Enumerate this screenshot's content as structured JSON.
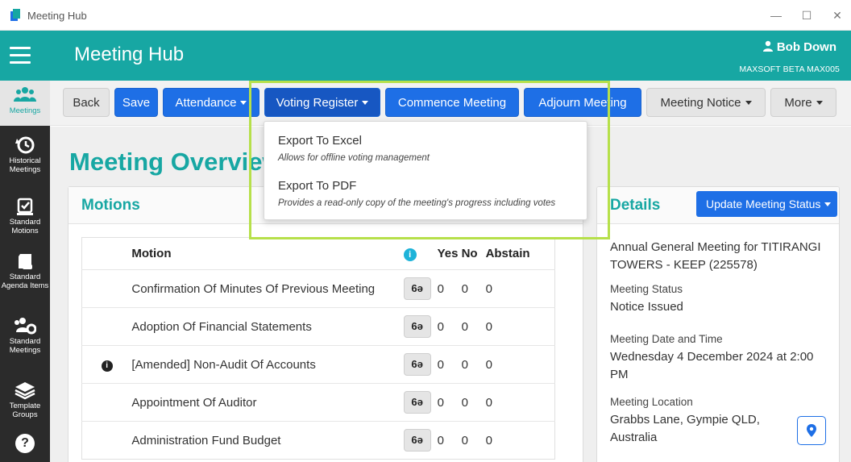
{
  "window": {
    "title": "Meeting Hub",
    "controls": [
      "—",
      "☐",
      "✕"
    ]
  },
  "header": {
    "title": "Meeting Hub",
    "user_name": "Bob Down",
    "user_sub": "MAXSOFT BETA MAX005"
  },
  "sidebar": {
    "items": [
      {
        "label": "Meetings",
        "icon": "people-group-icon",
        "active": true
      },
      {
        "label": "Historical Meetings",
        "icon": "history-icon"
      },
      {
        "label": "Standard Motions",
        "icon": "check-box-icon"
      },
      {
        "label": "Standard Agenda Items",
        "icon": "scroll-icon"
      },
      {
        "label": "Standard Meetings",
        "icon": "people-gear-icon"
      },
      {
        "label": "Template Groups",
        "icon": "layers-icon"
      },
      {
        "label": "?",
        "icon": "help-icon"
      }
    ]
  },
  "toolbar": {
    "back": "Back",
    "save": "Save",
    "attendance": "Attendance",
    "voting_register": "Voting Register",
    "commence": "Commence Meeting",
    "adjourn": "Adjourn Meeting",
    "notice": "Meeting Notice",
    "more": "More"
  },
  "dropdown": {
    "items": [
      {
        "label": "Export To Excel",
        "desc": "Allows for offline voting management"
      },
      {
        "label": "Export To PDF",
        "desc": "Provides a read-only copy of the meeting's progress including votes"
      }
    ]
  },
  "page": {
    "title": "Meeting Overview"
  },
  "motions": {
    "title": "Motions",
    "columns": {
      "motion": "Motion",
      "info": "i",
      "yes": "Yes",
      "no": "No",
      "abstain": "Abstain"
    },
    "view_glyph": "6ə",
    "rows": [
      {
        "name": "Confirmation Of Minutes Of Previous Meeting",
        "yes": "0",
        "no": "0",
        "abstain": "0",
        "flag": ""
      },
      {
        "name": "Adoption Of Financial Statements",
        "yes": "0",
        "no": "0",
        "abstain": "0",
        "flag": ""
      },
      {
        "name": "[Amended] Non-Audit Of Accounts",
        "yes": "0",
        "no": "0",
        "abstain": "0",
        "flag": "i"
      },
      {
        "name": "Appointment Of Auditor",
        "yes": "0",
        "no": "0",
        "abstain": "0",
        "flag": ""
      },
      {
        "name": "Administration Fund Budget",
        "yes": "0",
        "no": "0",
        "abstain": "0",
        "flag": ""
      }
    ]
  },
  "details": {
    "title": "Details",
    "update_button": "Update Meeting Status",
    "meeting_name": "Annual General Meeting for TITIRANGI TOWERS - KEEP (225578)",
    "status_label": "Meeting Status",
    "status_value": "Notice Issued",
    "datetime_label": "Meeting Date and Time",
    "datetime_value": "Wednesday 4 December 2024 at 2:00 PM",
    "location_label": "Meeting Location",
    "location_value": "Grabbs Lane, Gympie QLD, Australia"
  },
  "colors": {
    "brand": "#17a7a3",
    "primary": "#1e6fe6",
    "sidebar": "#2b2b2b",
    "highlight": "#b6e04a"
  }
}
